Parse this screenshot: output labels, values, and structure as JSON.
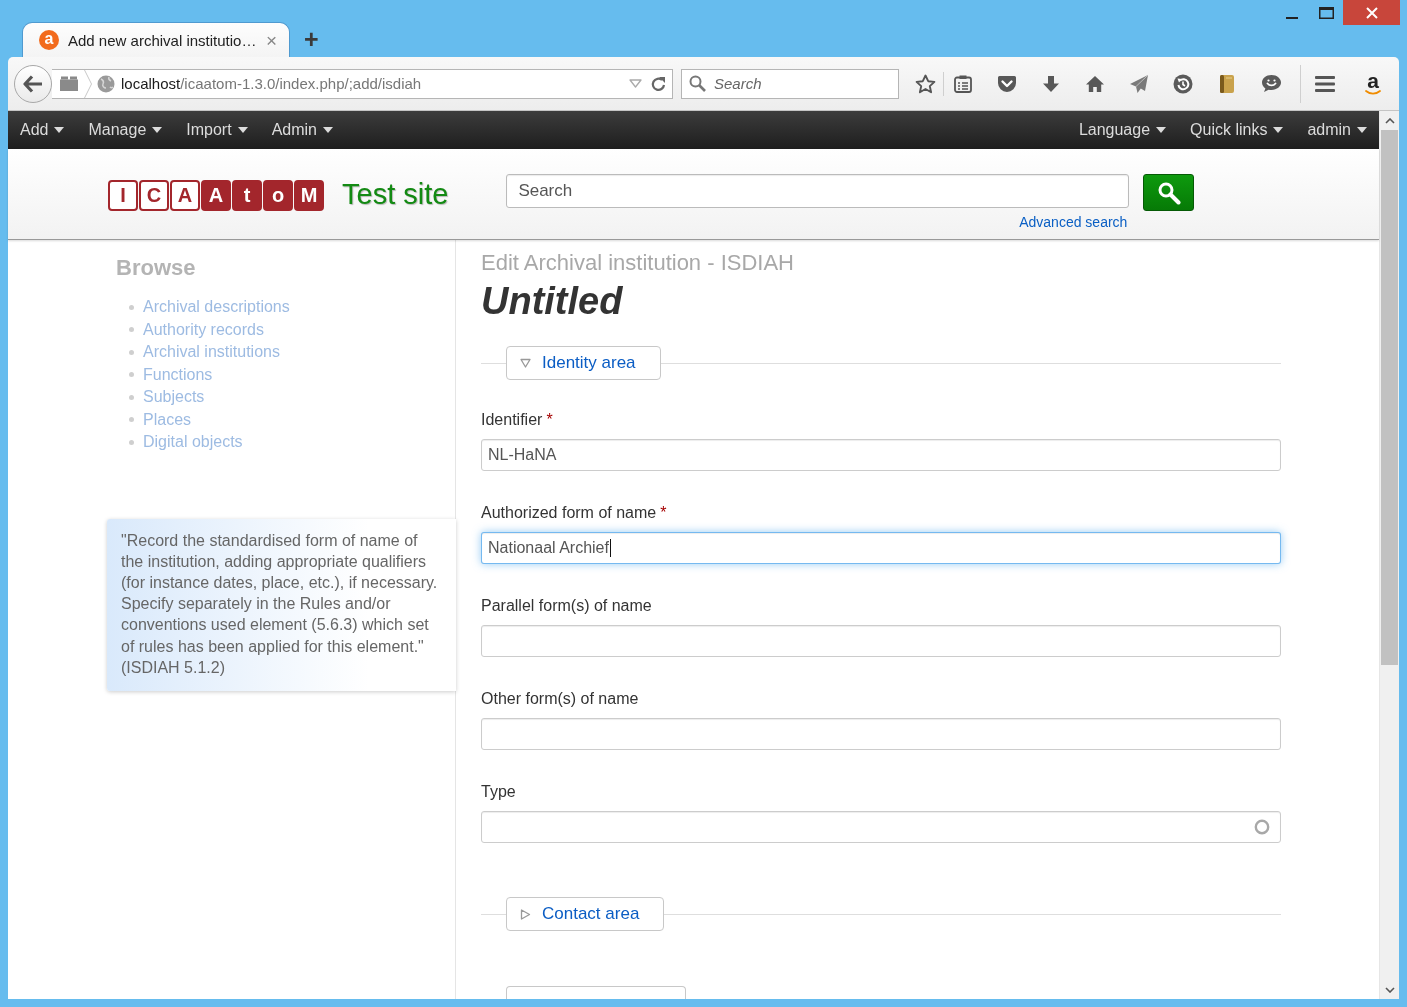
{
  "browser": {
    "tabs": [
      {
        "favicon": "a",
        "title": "Add new archival institutio…",
        "close": "×",
        "selected": true
      }
    ],
    "new_tab": "+",
    "address": {
      "host": "localhost",
      "path": "/icaatom-1.3.0/index.php/;add/isdiah"
    },
    "search": {
      "placeholder": "Search"
    },
    "extension_label": "a"
  },
  "navbar": {
    "left": [
      "Add",
      "Manage",
      "Import",
      "Admin"
    ],
    "right": [
      "Language",
      "Quick links",
      "admin"
    ]
  },
  "header": {
    "logo": [
      {
        "char": "I",
        "filled": false
      },
      {
        "char": "C",
        "filled": false
      },
      {
        "char": "A",
        "filled": false
      },
      {
        "char": "A",
        "filled": true
      },
      {
        "char": "t",
        "filled": true
      },
      {
        "char": "o",
        "filled": true
      },
      {
        "char": "M",
        "filled": true
      }
    ],
    "site_name": "Test site",
    "search": {
      "placeholder": "Search"
    },
    "advanced_search": "Advanced search"
  },
  "sidebar": {
    "heading": "Browse",
    "items": [
      "Archival descriptions",
      "Authority records",
      "Archival institutions",
      "Functions",
      "Subjects",
      "Places",
      "Digital objects"
    ]
  },
  "help_tooltip": "\"Record the standardised form of name of the institution, adding appropriate qualifiers (for instance dates, place, etc.), if necessary. Specify separately in the Rules and/or conventions used element (5.6.3) which set of rules has been applied for this element.\" (ISDIAH 5.1.2)",
  "main": {
    "subtitle": "Edit Archival institution - ISDIAH",
    "title": "Untitled",
    "sections": [
      {
        "title": "Identity area",
        "expanded": true,
        "fields": [
          {
            "kind": "text",
            "label": "Identifier",
            "required_mark": "*",
            "value": "NL-HaNA",
            "focused": false
          },
          {
            "kind": "text",
            "label": "Authorized form of name",
            "required_mark": "*",
            "value": "Nationaal Archief",
            "focused": true
          },
          {
            "kind": "text",
            "label": "Parallel form(s) of name",
            "focused": false
          },
          {
            "kind": "text",
            "label": "Other form(s) of name",
            "focused": false
          },
          {
            "kind": "autocomplete",
            "label": "Type",
            "focused": false
          }
        ]
      },
      {
        "title": "Contact area",
        "expanded": false
      }
    ],
    "truncated_section": true
  }
}
